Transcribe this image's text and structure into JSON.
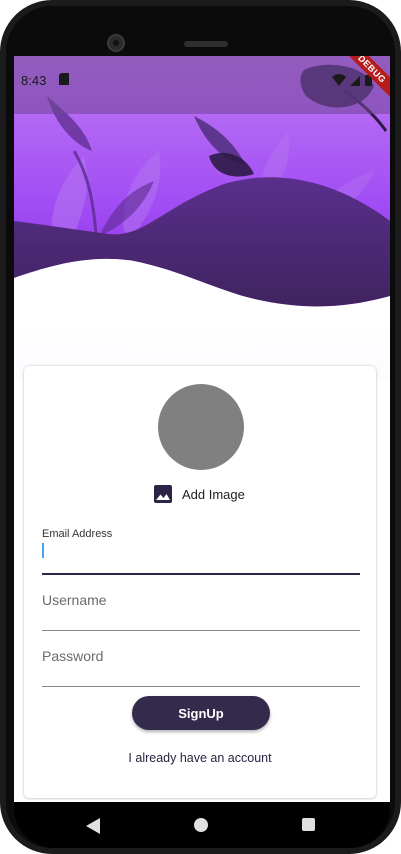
{
  "status_bar": {
    "time": "8:43",
    "debug_banner": "DEBUG"
  },
  "signup_form": {
    "add_image_label": "Add Image",
    "email": {
      "label": "Email Address",
      "value": ""
    },
    "username": {
      "placeholder": "Username"
    },
    "password": {
      "placeholder": "Password"
    },
    "signup_button": "SignUp",
    "login_link": "I already have an account"
  },
  "colors": {
    "accent": "#332a4c",
    "hero_purple": "#a24ef5",
    "wave_dark": "#4f2f7d",
    "avatar_placeholder": "#808080"
  },
  "icons": {
    "add_image": "image-icon",
    "status_sd": "sd-card-icon",
    "status_wifi": "wifi-icon",
    "status_signal": "signal-icon",
    "status_battery": "battery-icon",
    "nav_back": "back-triangle-icon",
    "nav_home": "home-circle-icon",
    "nav_recent": "recent-square-icon"
  }
}
